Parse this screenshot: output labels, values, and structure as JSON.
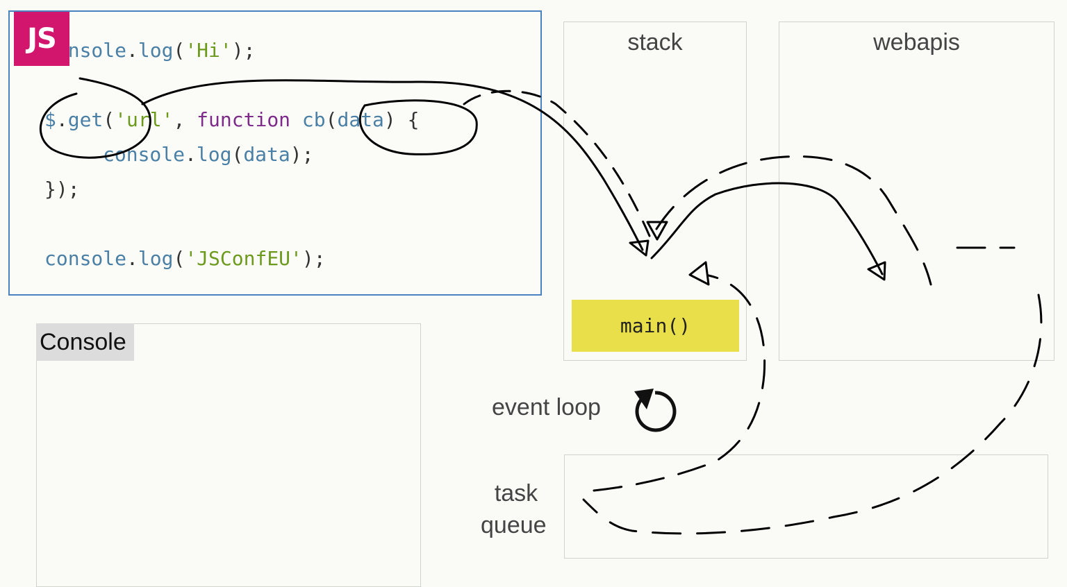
{
  "code": {
    "badge": "JS",
    "line1": {
      "a": "console",
      "b": ".",
      "c": "log",
      "d": "(",
      "e": "'Hi'",
      "f": ");"
    },
    "line2": {
      "a": "$",
      "b": ".",
      "c": "get",
      "d": "(",
      "e": "'url'",
      "f": ", ",
      "g": "function",
      "h": " ",
      "i": "cb",
      "j": "(",
      "k": "data",
      "l": ") {"
    },
    "line3": {
      "a": "console",
      "b": ".",
      "c": "log",
      "d": "(",
      "e": "data",
      "f": ");"
    },
    "line4": "});",
    "line5": {
      "a": "console",
      "b": ".",
      "c": "log",
      "d": "(",
      "e": "'JSConfEU'",
      "f": ");"
    }
  },
  "console": {
    "label": "Console"
  },
  "stack": {
    "title": "stack",
    "frames": [
      "main()"
    ]
  },
  "webapis": {
    "title": "webapis"
  },
  "event_loop": {
    "label": "event loop",
    "icon": "refresh-icon"
  },
  "task_queue": {
    "label_line1": "task",
    "label_line2": "queue"
  },
  "colors": {
    "badge": "#d2156d",
    "code_border": "#4a82c0",
    "stack_frame": "#e8df4a",
    "keyword": "#7e2a8a",
    "string": "#6c9a1c",
    "identifier": "#4a7fa6"
  }
}
